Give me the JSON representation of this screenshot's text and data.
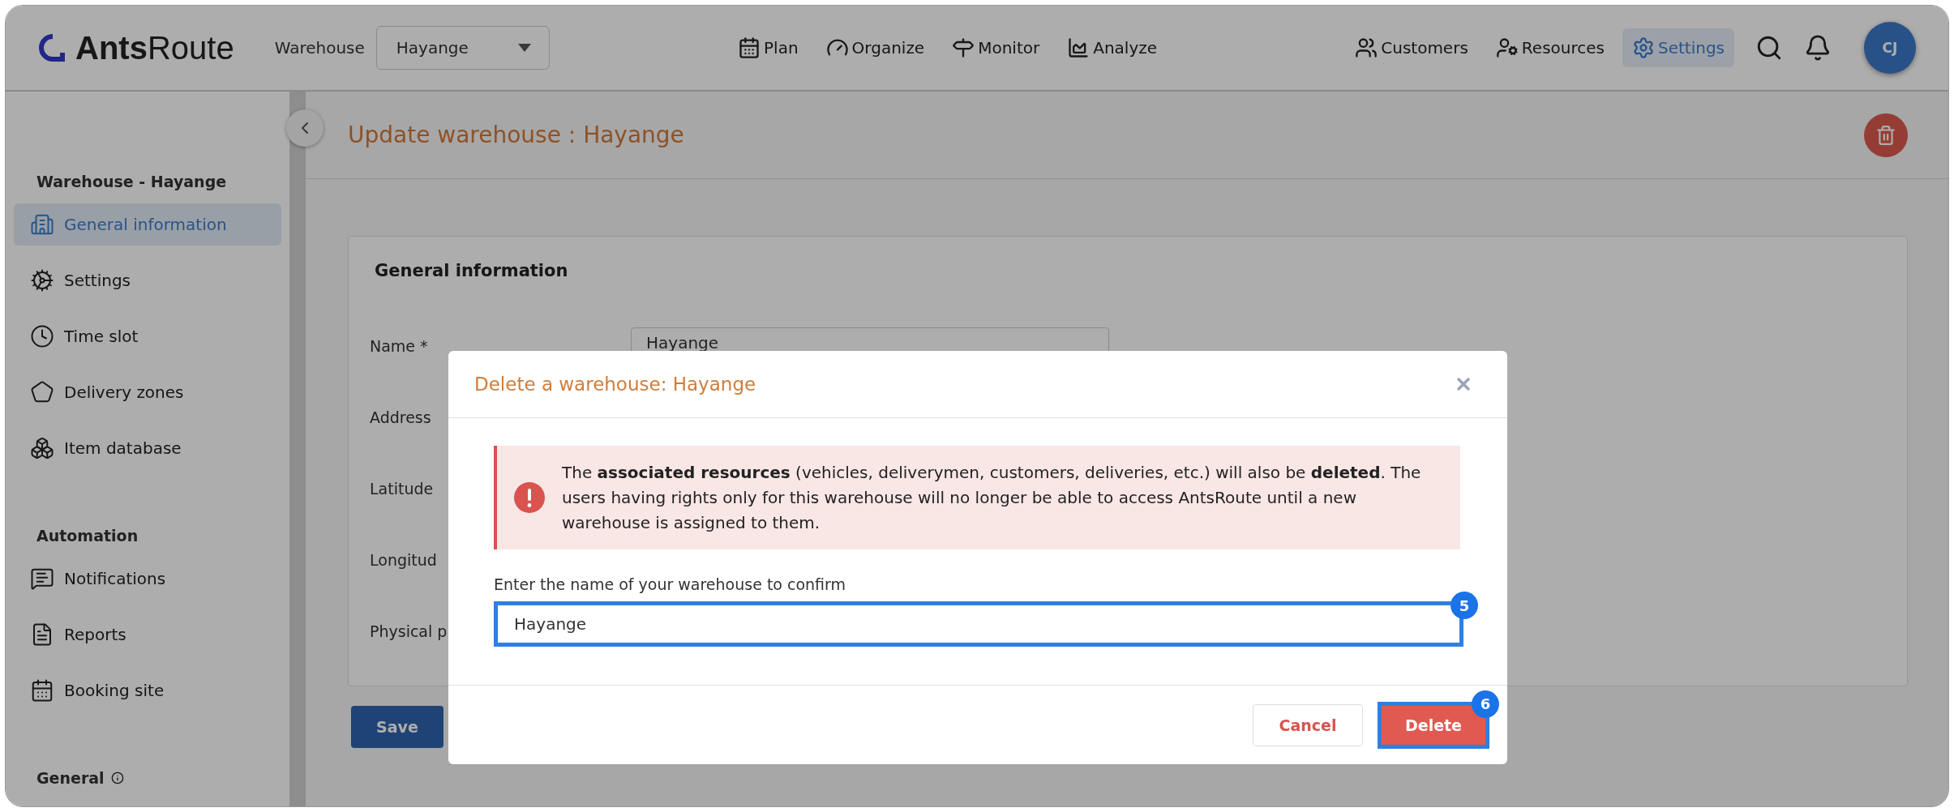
{
  "header": {
    "logo": "**Ants**Route",
    "warehouse_label": "Warehouse",
    "warehouse_select": "Hayange",
    "nav": [
      {
        "label": "Plan"
      },
      {
        "label": "Organize"
      },
      {
        "label": "Monitor"
      },
      {
        "label": "Analyze"
      }
    ],
    "right_nav": [
      {
        "label": "Customers",
        "selected": false
      },
      {
        "label": "Resources",
        "selected": false
      },
      {
        "label": "Settings",
        "selected": true
      }
    ],
    "avatar": "CJ"
  },
  "sidebar": {
    "groups": [
      {
        "heading": "Warehouse - Hayange",
        "info": false,
        "items": [
          {
            "label": "General information",
            "selected": true
          },
          {
            "label": "Settings",
            "selected": false
          },
          {
            "label": "Time slot",
            "selected": false
          },
          {
            "label": "Delivery zones",
            "selected": false
          },
          {
            "label": "Item database",
            "selected": false
          }
        ]
      },
      {
        "heading": "Automation",
        "info": false,
        "items": [
          {
            "label": "Notifications",
            "selected": false
          },
          {
            "label": "Reports",
            "selected": false
          },
          {
            "label": "Booking site",
            "selected": false
          }
        ]
      },
      {
        "heading": "General",
        "info": true
      }
    ]
  },
  "page": {
    "title": "Update warehouse : Hayange"
  },
  "card": {
    "title": "General information",
    "fields": [
      {
        "label": "Name *",
        "value": "Hayange"
      },
      {
        "label": "Address"
      },
      {
        "label": "Latitude"
      },
      {
        "label": "Longitud"
      },
      {
        "label": "Physical p"
      }
    ],
    "save": "Save"
  },
  "modal": {
    "title": "Delete a warehouse: Hayange",
    "alert": "The **associated resources** (vehicles, deliverymen, customers, deliveries, etc.) will also be **deleted**. The users having rights only for this warehouse will no longer be able to access AntsRoute until a new warehouse is assigned to them.",
    "confirm_label": "Enter the name of your warehouse to confirm",
    "confirm_value": "Hayange",
    "input_badge": "5",
    "cancel": "Cancel",
    "delete": "Delete",
    "delete_badge": "6"
  }
}
